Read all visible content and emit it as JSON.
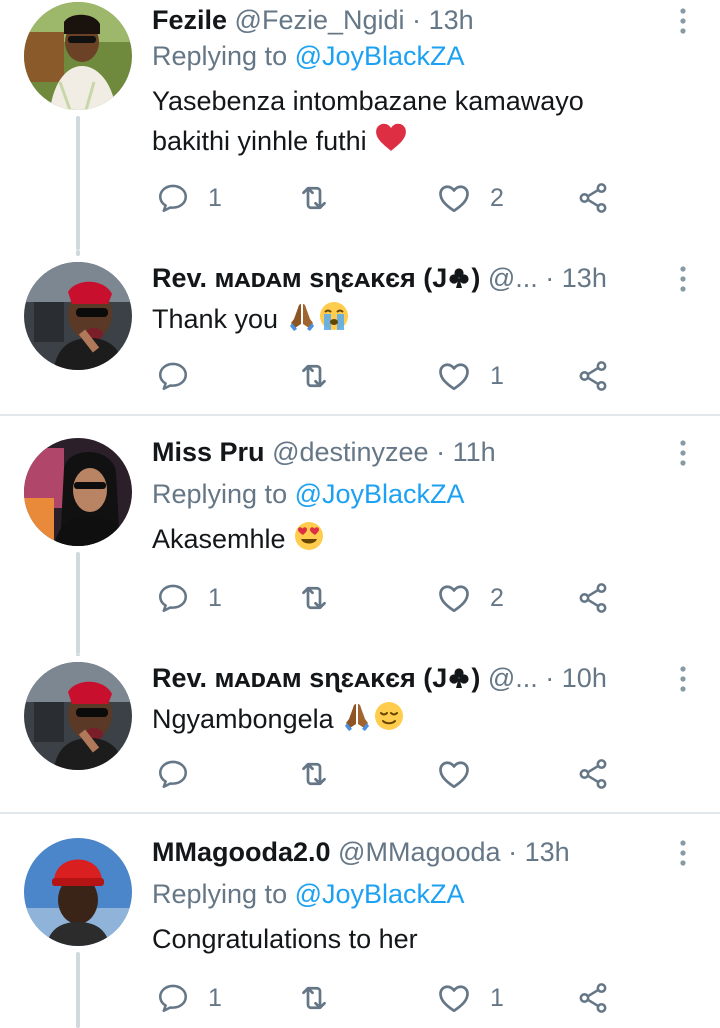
{
  "tweets": [
    {
      "name": "Fezile",
      "handle": "@Fezie_Ngidi",
      "dot": "·",
      "time": "13h",
      "replying_prefix": "Replying to ",
      "replying_to": "@JoyBlackZA",
      "text_line1": "Yasebenza intombazane kamawayo",
      "text_line2": "bakithi yinhle futhi",
      "reply_count": "1",
      "like_count": "2"
    },
    {
      "name": "Rev. ᴍᴀᴅᴀᴍ sɳɛᴀᴋєя (J",
      "name_end": ")",
      "handle": "@...",
      "dot": "·",
      "time": "13h",
      "text": "Thank you",
      "reply_count": "",
      "like_count": "1"
    },
    {
      "name": "Miss Pru",
      "handle": "@destinyzee",
      "dot": "·",
      "time": "11h",
      "replying_prefix": "Replying to ",
      "replying_to": "@JoyBlackZA",
      "text": "Akasemhle",
      "reply_count": "1",
      "like_count": "2"
    },
    {
      "name": "Rev. ᴍᴀᴅᴀᴍ sɳɛᴀᴋєя (J",
      "name_end": ")",
      "handle": "@...",
      "dot": "·",
      "time": "10h",
      "text": "Ngyambongela",
      "reply_count": "",
      "like_count": ""
    },
    {
      "name": "MMagooda2.0",
      "handle": "@MMagooda",
      "dot": "·",
      "time": "13h",
      "replying_prefix": "Replying to ",
      "replying_to": "@JoyBlackZA",
      "text": "Congratulations to her",
      "reply_count": "1",
      "like_count": "1"
    }
  ],
  "colors": {
    "text": "#14171a",
    "secondary": "#657786",
    "link": "#1da1f2",
    "divider": "#e1e8ed",
    "thread_line": "#cfd9de"
  },
  "icons": [
    "reply-icon",
    "retweet-icon",
    "like-icon",
    "share-icon",
    "more-icon",
    "heart-emoji",
    "folded-hands-emoji",
    "crying-face-emoji",
    "heart-eyes-emoji",
    "relieved-face-emoji",
    "club-suit"
  ]
}
